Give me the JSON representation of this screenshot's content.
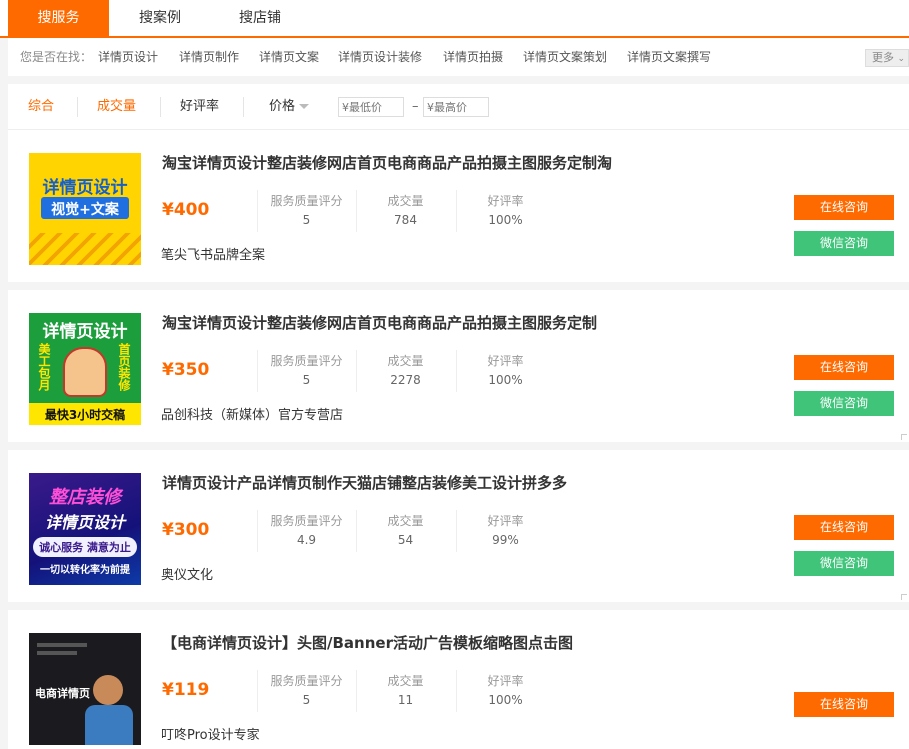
{
  "tabs": [
    {
      "label": "搜服务"
    },
    {
      "label": "搜案例"
    },
    {
      "label": "搜店铺"
    }
  ],
  "suggest": {
    "prefix": "您是否在找：",
    "links": [
      "详情页设计",
      "详情页制作",
      "详情页文案",
      "详情页设计装修",
      "详情页拍摄",
      "详情页文案策划",
      "详情页文案撰写"
    ],
    "more": "更多"
  },
  "filter": {
    "sort_default": "综合",
    "sort_sales": "成交量",
    "sort_rating": "好评率",
    "sort_price": "价格",
    "min_placeholder": "¥最低价",
    "max_placeholder": "¥最高价",
    "dash": "–"
  },
  "colors": {
    "accent": "#ff6a00",
    "consult_green": "#3fc47a"
  },
  "stat_labels": {
    "quality": "服务质量评分",
    "sales": "成交量",
    "rating": "好评率"
  },
  "buttons": {
    "consult": "在线咨询",
    "wechat": "微信咨询"
  },
  "items": [
    {
      "title": "淘宝详情页设计整店装修网店首页电商商品产品拍摄主图服务定制淘",
      "price": "¥400",
      "quality": "5",
      "sales": "784",
      "rating": "100%",
      "shop": "笔尖飞书品牌全案",
      "thumb": {
        "line1": "详情页设计",
        "line2": "视觉+文案"
      }
    },
    {
      "title": "淘宝详情页设计整店装修网店首页电商商品产品拍摄主图服务定制",
      "price": "¥350",
      "quality": "5",
      "sales": "2278",
      "rating": "100%",
      "shop": "品创科技（新媒体）官方专营店",
      "thumb": {
        "line1": "详情页设计",
        "left": "美工包月",
        "right": "首页装修",
        "bottom": "最快3小时交稿"
      }
    },
    {
      "title": "详情页设计产品详情页制作天猫店铺整店装修美工设计拼多多",
      "price": "¥300",
      "quality": "4.9",
      "sales": "54",
      "rating": "99%",
      "shop": "奥仪文化",
      "thumb": {
        "line1": "整店装修",
        "line2": "详情页设计",
        "line3": "诚心服务 满意为止",
        "line4": "一切以转化率为前提"
      }
    },
    {
      "title": "【电商详情页设计】头图/Banner活动广告模板缩略图点击图",
      "price": "¥119",
      "quality": "5",
      "sales": "11",
      "rating": "100%",
      "shop": "叮咚Pro设计专家",
      "thumb": {
        "line1": "电商详情页"
      }
    }
  ]
}
